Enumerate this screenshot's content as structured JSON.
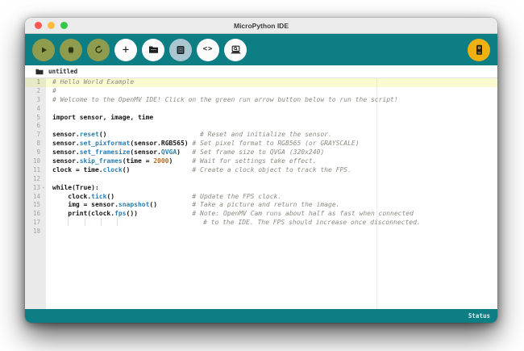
{
  "window": {
    "title": "MicroPython IDE"
  },
  "colors": {
    "toolbar_teal": "#0c7e84",
    "run_button_olive": "#8f9b4d",
    "save_button_blue": "#a9c6d1",
    "connect_button_amber": "#eeb111",
    "current_line_highlight": "#fbfbd2",
    "function_blue": "#2e7eb0",
    "number_orange": "#c06a1d",
    "comment_gray": "#8b8b84"
  },
  "toolbar": {
    "buttons": [
      {
        "name": "run",
        "icon": "play-icon"
      },
      {
        "name": "stop",
        "icon": "stop-icon"
      },
      {
        "name": "reset",
        "icon": "reset-icon"
      },
      {
        "name": "new-file",
        "icon": "plus-icon"
      },
      {
        "name": "open-file",
        "icon": "folder-icon"
      },
      {
        "name": "save",
        "icon": "save-icon"
      },
      {
        "name": "serial-terminal",
        "icon": "code-icon"
      },
      {
        "name": "open-terminal",
        "icon": "laptop-icon"
      },
      {
        "name": "connect",
        "icon": "camera-icon"
      }
    ]
  },
  "tabbar": {
    "file_label": "untitled"
  },
  "statusbar": {
    "label": "Status"
  },
  "editor": {
    "lines": [
      {
        "n": "1",
        "hl": true,
        "tokens": [
          [
            "# Hello World Example",
            "c"
          ]
        ]
      },
      {
        "n": "2",
        "tokens": [
          [
            "#",
            "c"
          ]
        ]
      },
      {
        "n": "3",
        "tokens": [
          [
            "# Welcome to the OpenMV IDE! Click on the green run arrow button below to run the script!",
            "c"
          ]
        ]
      },
      {
        "n": "4",
        "tokens": []
      },
      {
        "n": "5",
        "tokens": [
          [
            "import sensor, image, time",
            "p"
          ]
        ]
      },
      {
        "n": "6",
        "tokens": []
      },
      {
        "n": "7",
        "tokens": [
          [
            "sensor.",
            "p"
          ],
          [
            "reset",
            "f"
          ],
          [
            "()",
            "p"
          ],
          [
            "                        ",
            "p"
          ],
          [
            "# Reset and initialize the sensor.",
            "c"
          ]
        ]
      },
      {
        "n": "8",
        "tokens": [
          [
            "sensor.",
            "p"
          ],
          [
            "set_pixformat",
            "f"
          ],
          [
            "(sensor.RGB565) ",
            "p"
          ],
          [
            "# Set pixel format to RGB565 (or GRAYSCALE)",
            "c"
          ]
        ]
      },
      {
        "n": "9",
        "tokens": [
          [
            "sensor.",
            "p"
          ],
          [
            "set_framesize",
            "f"
          ],
          [
            "(sensor.",
            "p"
          ],
          [
            "QVGA",
            "f"
          ],
          [
            ")   ",
            "p"
          ],
          [
            "# Set frame size to QVGA (320x240)",
            "c"
          ]
        ]
      },
      {
        "n": "10",
        "tokens": [
          [
            "sensor.",
            "p"
          ],
          [
            "skip_frames",
            "f"
          ],
          [
            "(time = ",
            "p"
          ],
          [
            "2000",
            "n"
          ],
          [
            ")     ",
            "p"
          ],
          [
            "# Wait for settings take effect.",
            "c"
          ]
        ]
      },
      {
        "n": "11",
        "tokens": [
          [
            "clock = time.",
            "p"
          ],
          [
            "clock",
            "f"
          ],
          [
            "()",
            "p"
          ],
          [
            "                ",
            "p"
          ],
          [
            "# Create a clock object to track the FPS.",
            "c"
          ]
        ]
      },
      {
        "n": "12",
        "tokens": []
      },
      {
        "n": "13",
        "fold": true,
        "tokens": [
          [
            "while(True):",
            "p"
          ]
        ]
      },
      {
        "n": "14",
        "tokens": [
          [
            "    clock.",
            "p"
          ],
          [
            "tick",
            "f"
          ],
          [
            "()",
            "p"
          ],
          [
            "                    ",
            "p"
          ],
          [
            "# Update the FPS clock.",
            "c"
          ]
        ]
      },
      {
        "n": "15",
        "tokens": [
          [
            "    img = sensor.",
            "p"
          ],
          [
            "snapshot",
            "f"
          ],
          [
            "()",
            "p"
          ],
          [
            "         ",
            "p"
          ],
          [
            "# Take a picture and return the image.",
            "c"
          ]
        ]
      },
      {
        "n": "16",
        "tokens": [
          [
            "    print(clock.",
            "p"
          ],
          [
            "fps",
            "f"
          ],
          [
            "())",
            "p"
          ],
          [
            "              ",
            "p"
          ],
          [
            "# Note: OpenMV Cam runs about half as fast when connected",
            "c"
          ]
        ]
      },
      {
        "n": "17",
        "tokens": [
          [
            "    ",
            "p"
          ],
          [
            "    ",
            "g"
          ],
          [
            "    ",
            "g"
          ],
          [
            "    ",
            "g"
          ],
          [
            "    ",
            "g"
          ],
          [
            "                  ",
            "p"
          ],
          [
            "# to the IDE. The FPS should increase once disconnected.",
            "c"
          ]
        ]
      },
      {
        "n": "18",
        "tokens": []
      }
    ]
  }
}
